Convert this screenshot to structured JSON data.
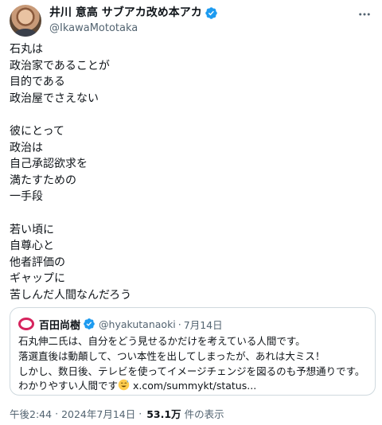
{
  "author": {
    "display_name": "井川 意高 サブアカ改め本アカ",
    "handle": "@IkawaMototaka",
    "avatar_icon": "user-avatar-photo",
    "verified_icon": "verified-badge-icon",
    "verified_color": "#1d9bf0"
  },
  "more_icon": "more-horizontal-icon",
  "tweet": {
    "text": "石丸は\n政治家であることが\n目的である\n政治屋でさえない\n\n彼にとって\n政治は\n自己承認欲求を\n満たすための\n一手段\n\n若い頃に\n自尊心と\n他者評価の\nギャップに\n苦しんだ人間なんだろう"
  },
  "quote": {
    "avatar_icon": "quoted-user-avatar",
    "display_name": "百田尚樹",
    "handle": "@hyakutanaoki",
    "separator": "·",
    "date": "7月14日",
    "lines": [
      "石丸伸二氏は、自分をどう見せるかだけを考えている人間です。",
      "落選直後は動顛して、つい本性を出してしまったが、あれは大ミス！",
      "しかし、数日後、テレビを使ってイメージチェンジを図るのも予想通りです。"
    ],
    "last_line_text": "わかりやすい人間です",
    "emoji_icon": "sweat-smile-emoji",
    "link": "x.com/summykt/status..."
  },
  "meta": {
    "time": "午後2:44",
    "separator1": "·",
    "date": "2024年7月14日",
    "separator2": "·",
    "views": "53.1万",
    "views_label": "件の表示"
  }
}
